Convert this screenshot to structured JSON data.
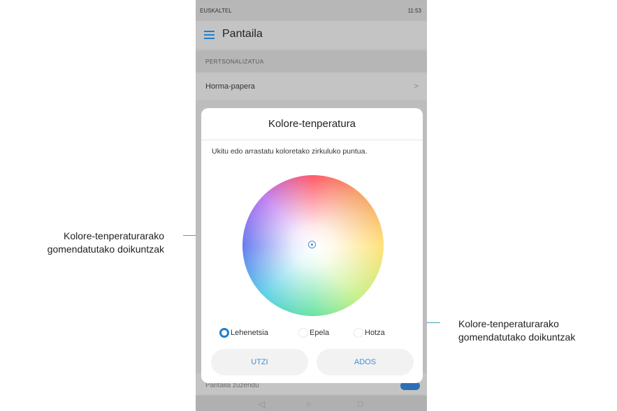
{
  "callouts": {
    "left": {
      "line1": "Kolore-tenperaturarako",
      "line2": "gomendatutako doikuntzak"
    },
    "right": {
      "line1": "Kolore-tenperaturarako",
      "line2": "gomendatutako doikuntzak"
    }
  },
  "statusbar": {
    "carrier": "EUSKALTEL",
    "right": "11:53"
  },
  "appbar": {
    "title": "Pantaila"
  },
  "section": {
    "label": "PERTSONALIZATUA"
  },
  "row": {
    "label": "Horma-papera",
    "chevron": ">"
  },
  "bottomrow": {
    "label": "Pantaila zuzendu"
  },
  "dialog": {
    "title": "Kolore-tenperatura",
    "instructions": "Ukitu edo arrastatu koloretako zirkuluko puntua.",
    "options": [
      {
        "label": "Lehenetsia",
        "selected": true
      },
      {
        "label": "Epela",
        "selected": false
      },
      {
        "label": "Hotza",
        "selected": false
      }
    ],
    "cancel_label": "UTZI",
    "ok_label": "ADOS"
  },
  "colors": {
    "accent": "#1e7fcf",
    "callout_line": "#3aa7b5"
  }
}
